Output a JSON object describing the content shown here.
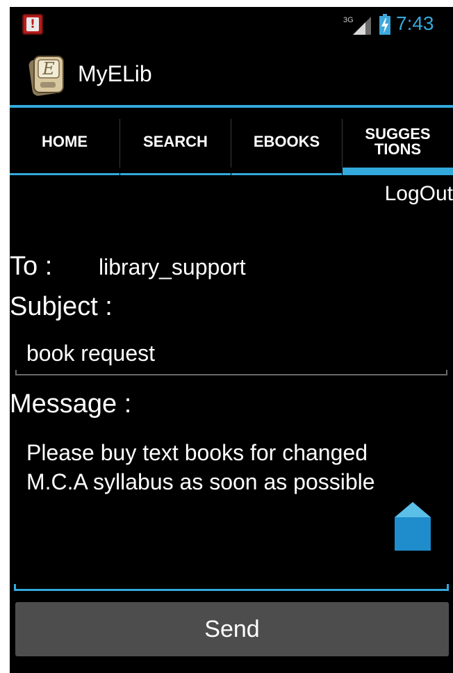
{
  "status_bar": {
    "network": "3G",
    "time": "7:43",
    "notification_icon": "alert-icon"
  },
  "app": {
    "title": "MyELib",
    "icon": "ebook-app-icon",
    "icon_letter": "E"
  },
  "tabs": [
    {
      "label": "HOME",
      "selected": false
    },
    {
      "label": "SEARCH",
      "selected": false
    },
    {
      "label": "EBOOKS",
      "selected": false
    },
    {
      "label": "SUGGES\nTIONS",
      "selected": true
    }
  ],
  "logout_label": "LogOut",
  "form": {
    "to_label": "To :",
    "to_value": "library_support",
    "subject_label": "Subject :",
    "subject_value": "book request",
    "message_label": "Message :",
    "message_value": "Please buy text books for changed\nM.C.A syllabus as soon as possible",
    "send_label": "Send"
  },
  "colors": {
    "accent": "#33a9dc",
    "background": "#000000",
    "button": "#4d4d4d"
  }
}
